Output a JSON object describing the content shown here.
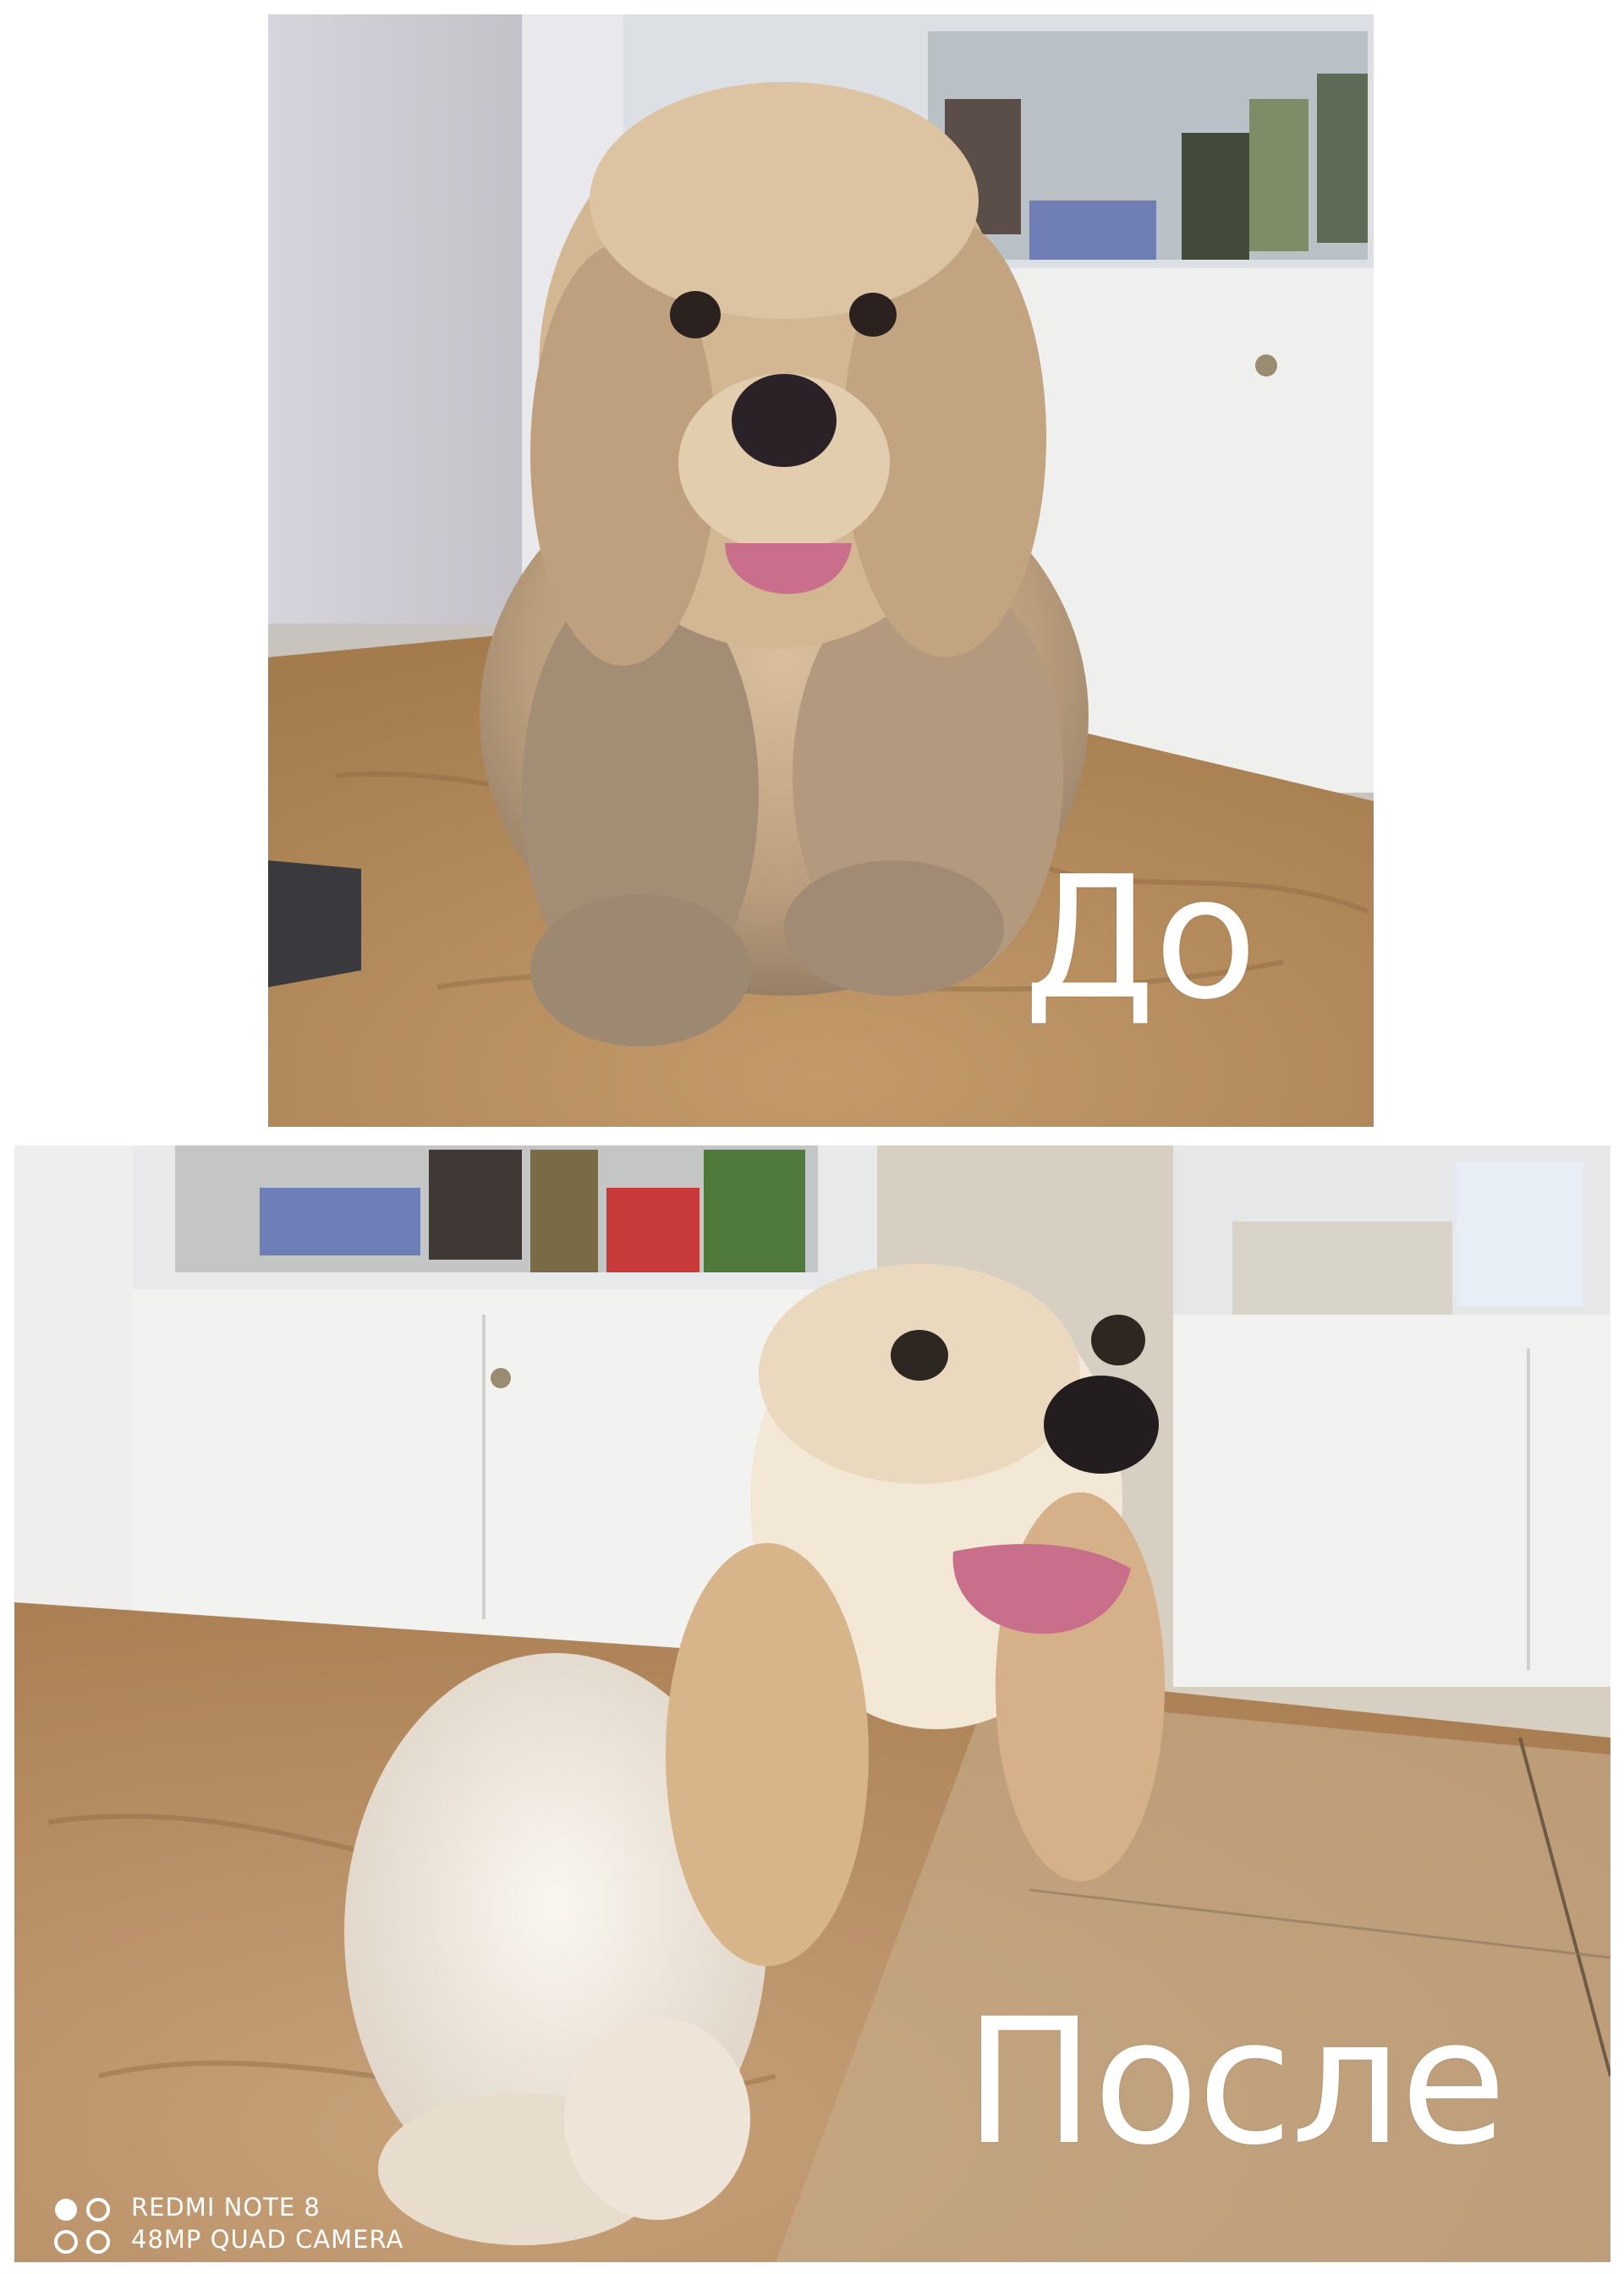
{
  "collage": {
    "before": {
      "caption": "До"
    },
    "after": {
      "caption": "После"
    }
  },
  "watermark": {
    "line1": "REDMI NOTE 8",
    "line2": "48MP QUAD CAMERA"
  },
  "colors": {
    "caption": "#ffffff",
    "background": "#ffffff",
    "floor_before": "#b7895a",
    "floor_after": "#b68a5f",
    "dog_before_coat": "#c7a884",
    "dog_after_coat": "#efe7dc",
    "dog_ears": "#d8b48a",
    "cabinet": "#f1f1ef",
    "tongue": "#c96f8c"
  }
}
